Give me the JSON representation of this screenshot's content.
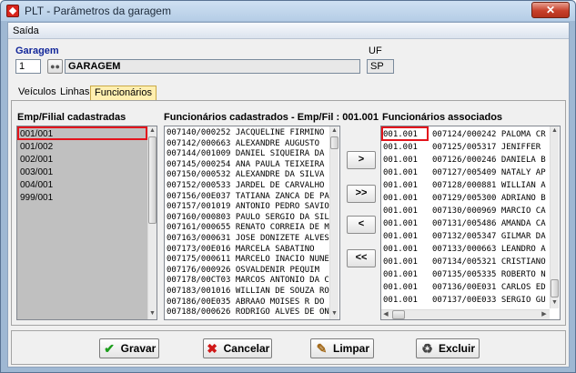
{
  "window": {
    "title": "PLT - Parâmetros da garagem",
    "close_label": "✕"
  },
  "menu": {
    "items": [
      "Saída"
    ]
  },
  "header": {
    "garagem_label": "Garagem",
    "garagem_code": "1",
    "garagem_name": "GARAGEM",
    "uf_label": "UF",
    "uf_value": "SP"
  },
  "tabs": [
    {
      "label": "Veículos",
      "active": false
    },
    {
      "label": "Linhas",
      "active": false
    },
    {
      "label": "Funcionários",
      "active": true
    }
  ],
  "emp_filial": {
    "header": "Emp/Filial cadastradas",
    "items": [
      "001/001",
      "001/002",
      "002/001",
      "003/001",
      "004/001",
      "999/001"
    ],
    "selected_index": 0
  },
  "funcionarios_cadastrados": {
    "header": "Funcionários cadastrados - Emp/Fil : 001.001",
    "items": [
      {
        "code": "007140/000252",
        "name": "JACQUELINE FIRMINO"
      },
      {
        "code": "007142/000663",
        "name": "ALEXANDRE AUGUSTO"
      },
      {
        "code": "007144/001009",
        "name": "DANIEL SIQUEIRA DA"
      },
      {
        "code": "007145/000254",
        "name": "ANA PAULA TEIXEIRA"
      },
      {
        "code": "007150/000532",
        "name": "ALEXANDRE DA SILVA"
      },
      {
        "code": "007152/000533",
        "name": "JARDEL DE CARVALHO"
      },
      {
        "code": "007156/00E037",
        "name": "TATIANA ZANCA DE PA"
      },
      {
        "code": "007157/001019",
        "name": "ANTONIO PEDRO SAVIO"
      },
      {
        "code": "007160/000803",
        "name": "PAULO SERGIO DA SIL"
      },
      {
        "code": "007161/000655",
        "name": "RENATO CORREIA DE M"
      },
      {
        "code": "007163/000631",
        "name": "JOSE DONIZETE ALVES"
      },
      {
        "code": "007173/00E016",
        "name": "MARCELA SABATINO"
      },
      {
        "code": "007175/000611",
        "name": "MARCELO INACIO NUNE"
      },
      {
        "code": "007176/000926",
        "name": "OSVALDENIR PEQUIM"
      },
      {
        "code": "007178/00CT03",
        "name": "MARCOS ANTONIO DA C"
      },
      {
        "code": "007183/001016",
        "name": "WILLIAN DE SOUZA RO"
      },
      {
        "code": "007186/00E035",
        "name": "ABRAAO MOISES R DO"
      },
      {
        "code": "007188/000626",
        "name": "RODRIGO ALVES DE ON"
      }
    ]
  },
  "funcionarios_associados": {
    "header": "Funcionários associados",
    "items": [
      {
        "empfil": "001.001",
        "code": "007124/000242",
        "name": "PALOMA CR"
      },
      {
        "empfil": "001.001",
        "code": "007125/005317",
        "name": "JENIFFER"
      },
      {
        "empfil": "001.001",
        "code": "007126/000246",
        "name": "DANIELA B"
      },
      {
        "empfil": "001.001",
        "code": "007127/005409",
        "name": "NATALY AP"
      },
      {
        "empfil": "001.001",
        "code": "007128/000881",
        "name": "WILLIAN A"
      },
      {
        "empfil": "001.001",
        "code": "007129/005300",
        "name": "ADRIANO B"
      },
      {
        "empfil": "001.001",
        "code": "007130/000969",
        "name": "MARCIO CA"
      },
      {
        "empfil": "001.001",
        "code": "007131/005486",
        "name": "AMANDA CA"
      },
      {
        "empfil": "001.001",
        "code": "007132/005347",
        "name": "GILMAR DA"
      },
      {
        "empfil": "001.001",
        "code": "007133/000663",
        "name": "LEANDRO A"
      },
      {
        "empfil": "001.001",
        "code": "007134/005321",
        "name": "CRISTIANO"
      },
      {
        "empfil": "001.001",
        "code": "007135/005335",
        "name": "ROBERTO N"
      },
      {
        "empfil": "001.001",
        "code": "007136/00E031",
        "name": "CARLOS ED"
      },
      {
        "empfil": "001.001",
        "code": "007137/00E033",
        "name": "SERGIO GU"
      }
    ]
  },
  "move_buttons": [
    ">",
    ">>",
    "<",
    "<<"
  ],
  "actions": {
    "gravar": {
      "label": "Gravar",
      "icon": "check-icon",
      "color": "#1d9e1d"
    },
    "cancelar": {
      "label": "Cancelar",
      "icon": "cross-icon",
      "color": "#d01818"
    },
    "limpar": {
      "label": "Limpar",
      "icon": "broom-icon"
    },
    "excluir": {
      "label": "Excluir",
      "icon": "trash-icon"
    }
  }
}
